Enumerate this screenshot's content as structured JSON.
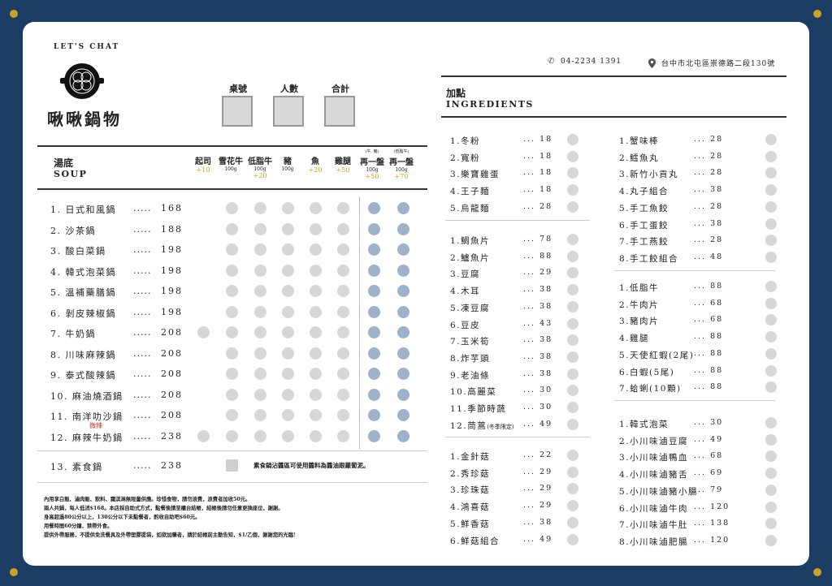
{
  "brand": {
    "tagline": "LET'S CHAT",
    "name": "啾啾鍋物"
  },
  "contact": {
    "phone": "04-2234 1391",
    "address": "台中市北屯區崇德路二段130號"
  },
  "order_boxes": [
    "桌號",
    "人數",
    "合計"
  ],
  "soup": {
    "title_zh": "湯底",
    "title_en": "SOUP",
    "columns": [
      {
        "name": "起司",
        "sub": "",
        "price": "+10",
        "tiny": ""
      },
      {
        "name": "雪花牛",
        "sub": "100g",
        "price": "",
        "tiny": ""
      },
      {
        "name": "低脂牛",
        "sub": "100g",
        "price": "+20",
        "tiny": ""
      },
      {
        "name": "豬",
        "sub": "100g",
        "price": "",
        "tiny": ""
      },
      {
        "name": "魚",
        "sub": "",
        "price": "+20",
        "tiny": ""
      },
      {
        "name": "雞腿",
        "sub": "",
        "price": "+50",
        "tiny": ""
      },
      {
        "name": "再一盤",
        "sub": "100g",
        "price": "+50",
        "tiny": "(牛, 豬)"
      },
      {
        "name": "再一盤",
        "sub": "100g",
        "price": "+70",
        "tiny": "(低脂牛)"
      }
    ],
    "items": [
      {
        "label": "1. 日式和風鍋",
        "dots": ".....",
        "price": "168"
      },
      {
        "label": "2. 沙茶鍋",
        "dots": ".....",
        "price": "188"
      },
      {
        "label": "3. 酸白菜鍋",
        "dots": ".....",
        "price": "198"
      },
      {
        "label": "4. 韓式泡菜鍋",
        "dots": ".....",
        "price": "198"
      },
      {
        "label": "5. 溫補藥膳鍋",
        "dots": ".....",
        "price": "198"
      },
      {
        "label": "6. 剝皮辣椒鍋",
        "dots": ".....",
        "price": "198"
      },
      {
        "label": "7. 牛奶鍋",
        "dots": ".....",
        "price": "208"
      },
      {
        "label": "8. 川味麻辣鍋",
        "dots": ".....",
        "price": "208"
      },
      {
        "label": "9. 泰式酸辣鍋",
        "dots": ".....",
        "price": "208"
      },
      {
        "label": "10. 麻油燒酒鍋",
        "dots": ".....",
        "price": "208"
      },
      {
        "label": "11. 南洋叻沙鍋",
        "dots": ".....",
        "price": "208",
        "badge": "微辣"
      },
      {
        "label": "12. 麻辣牛奶鍋",
        "dots": ".....",
        "price": "238"
      }
    ],
    "veg": {
      "label": "13. 素食鍋",
      "dots": ".....",
      "price": "238",
      "note": "素食鍋沾醬區可使用醬料為醬油跟蘿蔔泥。"
    }
  },
  "notes": [
    "內用享白飯、滷肉飯、飲料、霜淇淋無限量供應。珍惜食物，請勿浪費，浪費者加收50元。",
    "兩人共鍋，每人低消$168。本店採自助式方式，點餐後請至櫃台結帳，結帳後請勿任意更換座位，謝謝。",
    "身高超過80公分以上，130公分以下未點餐者，酌收自助吧$60元。",
    "用餐時間60分鐘，禁帶外食。",
    "提供外帶服務，不提供免洗餐具及外帶塑膠提袋，如欲加購者，請於結帳前主動告知，$1/乙個，謝謝您的光臨!"
  ],
  "ingredients": {
    "title_zh": "加點",
    "title_en": "INGREDIENTS",
    "left_groups": [
      [
        {
          "name": "1.冬粉",
          "price": "... 18"
        },
        {
          "name": "2.寬粉",
          "price": "... 18"
        },
        {
          "name": "3.樂寶雞蛋",
          "price": "... 18"
        },
        {
          "name": "4.王子麵",
          "price": "... 18"
        },
        {
          "name": "5.烏龍麵",
          "price": "... 28"
        }
      ],
      [
        {
          "name": "1.鯛魚片",
          "price": "... 78"
        },
        {
          "name": "2.鱸魚片",
          "price": "... 88"
        },
        {
          "name": "3.豆腐",
          "price": "... 29"
        },
        {
          "name": "4.木耳",
          "price": "... 38"
        },
        {
          "name": "5.凍豆腐",
          "price": "... 38"
        },
        {
          "name": "6.豆皮",
          "price": "... 43"
        },
        {
          "name": "7.玉米筍",
          "price": "... 38"
        },
        {
          "name": "8.炸芋頭",
          "price": "... 38"
        },
        {
          "name": "9.老油條",
          "price": "... 38"
        },
        {
          "name": "10.高麗菜",
          "price": "... 30"
        },
        {
          "name": "11.季節時蔬",
          "price": "... 30"
        },
        {
          "name": "12.茼蒿",
          "small": "(冬季限定)",
          "price": "... 49"
        }
      ],
      [
        {
          "name": "1.金針菇",
          "price": "... 22"
        },
        {
          "name": "2.秀珍菇",
          "price": "... 29"
        },
        {
          "name": "3.珍珠菇",
          "price": "... 29"
        },
        {
          "name": "4.鴻喜菇",
          "price": "... 29"
        },
        {
          "name": "5.鮮香菇",
          "price": "... 38"
        },
        {
          "name": "6.鮮菇組合",
          "price": "... 49"
        }
      ]
    ],
    "right_groups": [
      [
        {
          "name": "1.蟹味棒",
          "price": "... 28"
        },
        {
          "name": "2.鱈魚丸",
          "price": "... 28"
        },
        {
          "name": "3.新竹小貢丸",
          "price": "... 28"
        },
        {
          "name": "4.丸子組合",
          "price": "... 38"
        },
        {
          "name": "5.手工魚餃",
          "price": "... 28"
        },
        {
          "name": "6.手工蛋餃",
          "price": "... 38"
        },
        {
          "name": "7.手工燕餃",
          "price": "... 28"
        },
        {
          "name": "8.手工餃組合",
          "price": "... 48"
        }
      ],
      [
        {
          "name": "1.低脂牛",
          "price": "... 88"
        },
        {
          "name": "2.牛肉片",
          "price": "... 68"
        },
        {
          "name": "3.豬肉片",
          "price": "... 68"
        },
        {
          "name": "4.雞腿",
          "price": "... 88"
        },
        {
          "name": "5.天使紅蝦(2尾)",
          "price": "... 88"
        },
        {
          "name": "6.白蝦(5尾)",
          "price": "... 88"
        },
        {
          "name": "7.蛤蜊(10顆)",
          "price": "... 88"
        }
      ],
      [
        {
          "name": "1.韓式泡菜",
          "price": "... 30"
        },
        {
          "name": "2.小川味滷豆腐",
          "price": "... 49"
        },
        {
          "name": "3.小川味滷鴨血",
          "price": "... 68"
        },
        {
          "name": "4.小川味滷豬舌",
          "price": "... 69"
        },
        {
          "name": "5.小川味滷豬小腸",
          "price": "... 79"
        },
        {
          "name": "6.小川味滷牛肉",
          "price": "... 120"
        },
        {
          "name": "7.小川味滷牛肚",
          "price": "... 138"
        },
        {
          "name": "8.小川味滷肥腸",
          "price": "... 120"
        }
      ]
    ]
  },
  "colors": {
    "background": "#1b3d63",
    "accent": "#c9a227",
    "circle": "#d7d7d7",
    "circle_blue": "#9fb2c9"
  }
}
